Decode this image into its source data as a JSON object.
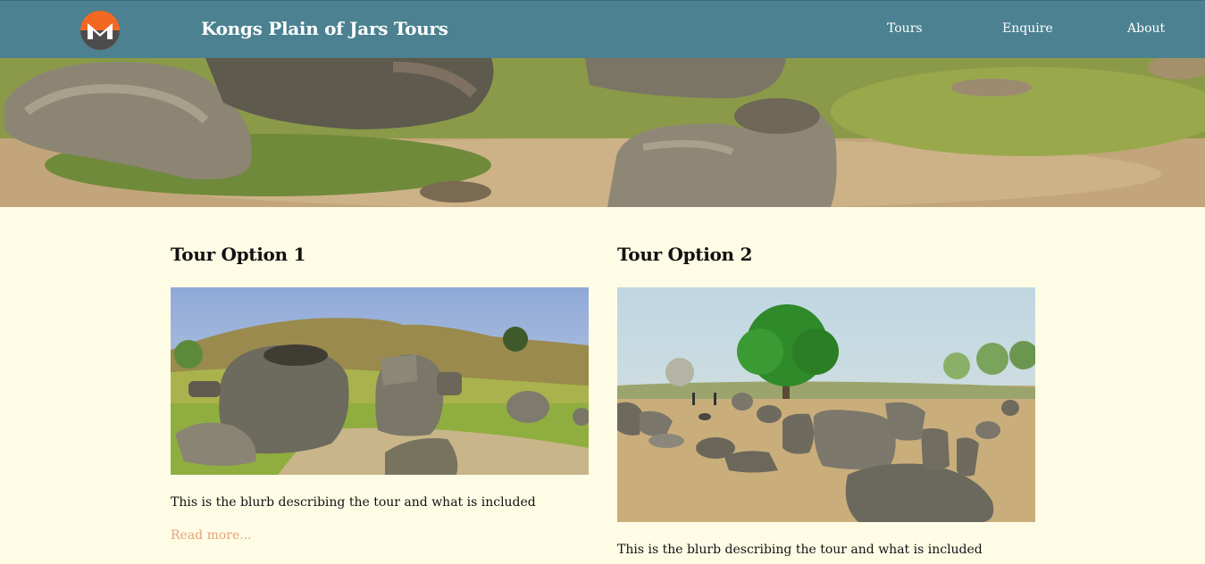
{
  "header": {
    "site_title": "Kongs Plain of Jars Tours",
    "nav": [
      {
        "label": "Tours"
      },
      {
        "label": "Enquire"
      },
      {
        "label": "About"
      }
    ],
    "logo_icon": "monero-logo-icon"
  },
  "colors": {
    "header_bg": "#4b8190",
    "page_bg": "#fffce6",
    "link": "#e5a47a",
    "logo_orange": "#f26822",
    "logo_gray": "#4c4c4c"
  },
  "tours": [
    {
      "title": "Tour Option 1",
      "blurb": "This is the blurb describing the tour and what is included",
      "link": "Read more..."
    },
    {
      "title": "Tour Option 2",
      "blurb": "This is the blurb describing the tour and what is included"
    }
  ]
}
